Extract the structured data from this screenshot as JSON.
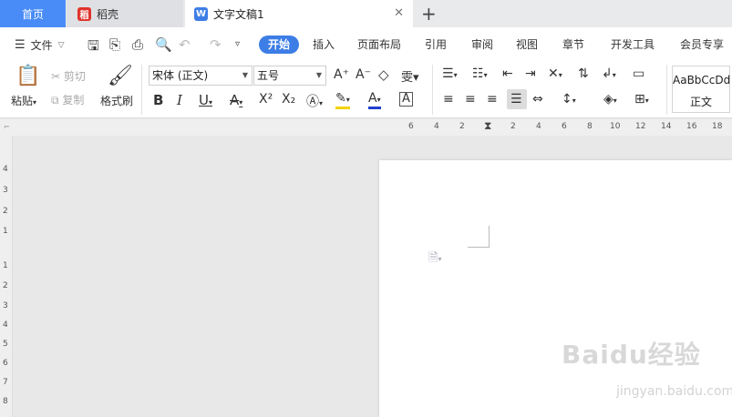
{
  "tabs": {
    "home": "首页",
    "daoke": "稻壳",
    "doc": "文字文稿1",
    "close": "✕",
    "add": "+"
  },
  "menu": {
    "file": "文件",
    "tabs": [
      "开始",
      "插入",
      "页面布局",
      "引用",
      "审阅",
      "视图",
      "章节",
      "开发工具",
      "会员专享"
    ]
  },
  "ribbon": {
    "paste": "粘贴",
    "cut": "剪切",
    "copy": "复制",
    "format_painter": "格式刷",
    "font_name": "宋体 (正文)",
    "font_size": "五号",
    "style_sample": "AaBbCcDd",
    "style_name": "正文"
  },
  "ruler": {
    "h_ticks": [
      "6",
      "4",
      "2",
      "2",
      "4",
      "6",
      "8",
      "10",
      "12",
      "14",
      "16",
      "18"
    ],
    "v_ticks": [
      "4",
      "3",
      "2",
      "1",
      "1",
      "2",
      "3",
      "4",
      "5",
      "6",
      "7",
      "8"
    ]
  },
  "watermark": {
    "main": "Baidu经验",
    "sub": "jingyan.baidu.com"
  }
}
